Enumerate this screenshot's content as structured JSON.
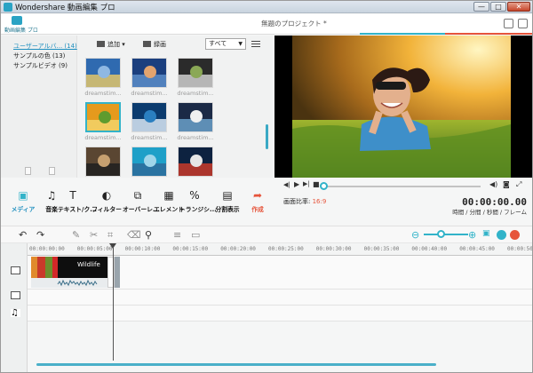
{
  "window": {
    "title": "Wondershare 動画編集 プロ",
    "project_title": "無題のプロジェクト *",
    "controls": {
      "minimize": "—",
      "maximize": "□",
      "close": "✕"
    }
  },
  "logo": {
    "name": "動画編集 プロ"
  },
  "accent_colors": {
    "teal": "#32b3c9",
    "red": "#e6543b"
  },
  "library": {
    "items": [
      {
        "label": "ユーザーアルバ... (14)",
        "selected": true
      },
      {
        "label": "サンプルの色 (13)",
        "selected": false
      },
      {
        "label": "サンプルビデオ (9)",
        "selected": false
      }
    ]
  },
  "media_toolbar": {
    "add": "追加",
    "record": "録画",
    "filter_value": "すべて"
  },
  "thumbnails": [
    {
      "label": "dreamstim...",
      "selected": false
    },
    {
      "label": "dreamstim...",
      "selected": false
    },
    {
      "label": "dreamstim...",
      "selected": false
    },
    {
      "label": "dreamstim...",
      "selected": true
    },
    {
      "label": "dreamstim...",
      "selected": false
    },
    {
      "label": "dreamstim...",
      "selected": false
    },
    {
      "label": "",
      "selected": false
    },
    {
      "label": "",
      "selected": false
    },
    {
      "label": "",
      "selected": false
    }
  ],
  "tools": [
    {
      "label": "メディア",
      "icon": "media-icon",
      "glyph": "▣",
      "active": true
    },
    {
      "label": "音楽",
      "icon": "music-icon",
      "glyph": "♫",
      "active": false
    },
    {
      "label": "テキスト/ク...",
      "icon": "text-icon",
      "glyph": "T",
      "active": false
    },
    {
      "label": "フィルター",
      "icon": "filter-icon",
      "glyph": "◐",
      "active": false
    },
    {
      "label": "オーバーレ...",
      "icon": "overlay-icon",
      "glyph": "⧉",
      "active": false
    },
    {
      "label": "エレメント",
      "icon": "element-icon",
      "glyph": "▦",
      "active": false
    },
    {
      "label": "トランジシ...",
      "icon": "transition-icon",
      "glyph": "%",
      "active": false
    },
    {
      "label": "分割表示",
      "icon": "split-icon",
      "glyph": "▤",
      "active": false
    },
    {
      "label": "作成",
      "icon": "export-icon",
      "glyph": "➦",
      "active": false
    }
  ],
  "player": {
    "aspect_label": "画面比率:",
    "aspect_value": "16:9",
    "timecode": "00:00:00.00",
    "time_format": "時間 / 分間 / 秒間 / フレーム",
    "progress": 0.0
  },
  "timeline": {
    "zoom": 0.3,
    "ruler": [
      "00:00:00:00",
      "00:00:05:00",
      "00:00:10:00",
      "00:00:15:00",
      "00:00:20:00",
      "00:00:25:00",
      "00:00:30:00",
      "00:00:35:00",
      "00:00:40:00",
      "00:00:45:00",
      "00:00:50:00"
    ],
    "clip_label": "Wildlife"
  }
}
